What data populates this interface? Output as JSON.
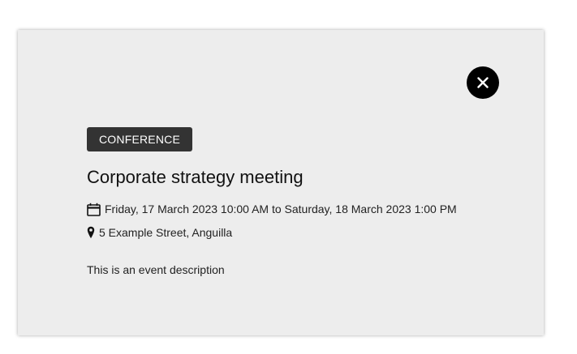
{
  "event": {
    "category": "CONFERENCE",
    "title": "Corporate strategy meeting",
    "date_range": "Friday, 17 March 2023 10:00 AM to Saturday, 18 March 2023 1:00 PM",
    "location": "5 Example Street, Anguilla",
    "description": "This is an event description"
  },
  "icons": {
    "close": "close-icon",
    "calendar": "calendar-icon",
    "location": "map-marker-icon"
  },
  "colors": {
    "modal_background": "#ededed",
    "tag_background": "#333333",
    "close_button": "#000000"
  }
}
